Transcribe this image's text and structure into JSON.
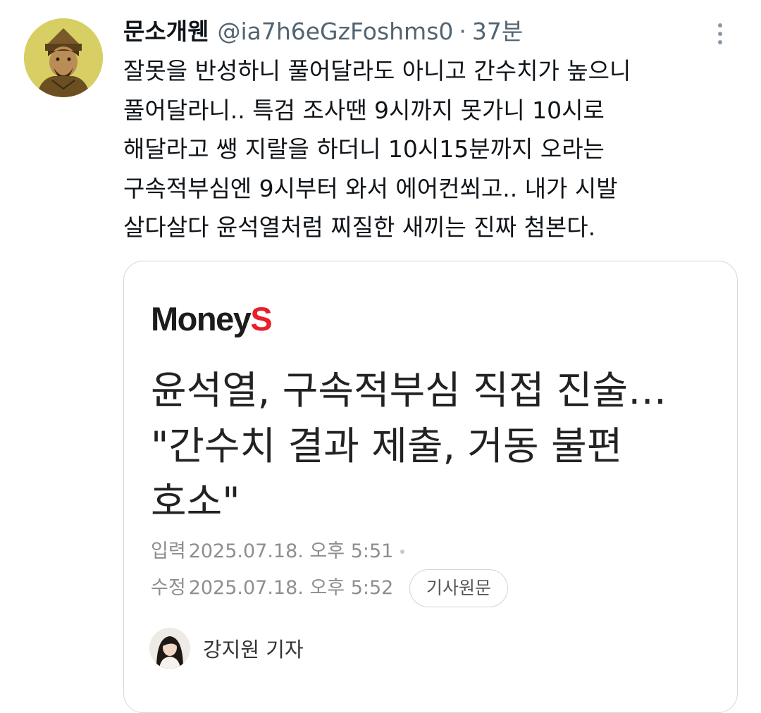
{
  "tweet": {
    "author_name": "문소개웬",
    "handle": "@ia7h6eGzFoshms0",
    "separator": "·",
    "time": "37분",
    "more_icon": "more-vertical-icon",
    "text_lines": [
      "잘못을 반성하니 풀어달라도 아니고 간수치가 높으니",
      "풀어달라니.. 특검 조사땐 9시까지 못가니 10시로",
      "해달라고 쌩 지랄을 하더니 10시15분까지 오라는",
      "구속적부심엔 9시부터 와서 에어컨쐬고.. 내가 시발",
      "살다살다 윤석열처럼 찌질한 새끼는 진짜 첨본다."
    ]
  },
  "article": {
    "logo_main": "Money",
    "logo_accent": "S",
    "headline_lines": [
      "윤석열, 구속적부심 직접 진술…",
      "\"간수치 결과 제출, 거동 불편",
      "호소\""
    ],
    "input_label": "입력",
    "input_datetime": "2025.07.18. 오후 5:51",
    "edit_label": "수정",
    "edit_datetime": "2025.07.18. 오후 5:52",
    "original_button_label": "기사원문",
    "reporter_name": "강지원 기자"
  },
  "colors": {
    "text_primary": "#0f1419",
    "text_secondary": "#536471",
    "card_border": "#cfd9de",
    "logo_accent": "#e8202a",
    "meta_gray": "#8e8e8e"
  }
}
